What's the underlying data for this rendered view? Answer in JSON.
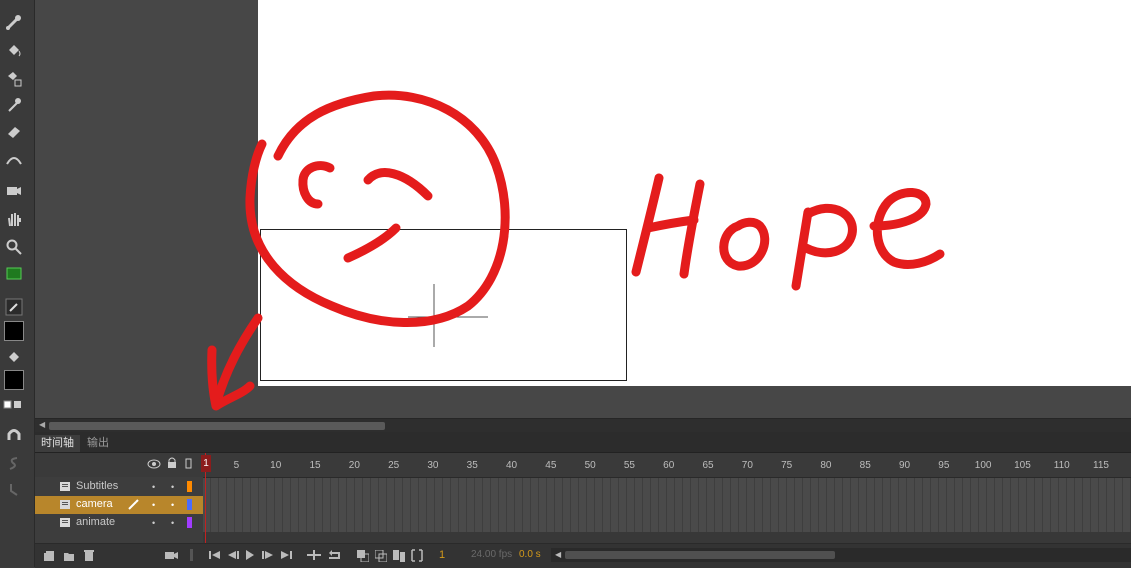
{
  "timeline": {
    "tabs": [
      {
        "label": "时间轴",
        "active": true
      },
      {
        "label": "输出",
        "active": false
      }
    ],
    "current_frame": "1",
    "ruler_ticks": [
      "1",
      "5",
      "10",
      "15",
      "20",
      "25",
      "30",
      "35",
      "40",
      "45",
      "50",
      "55",
      "60",
      "65",
      "70",
      "75",
      "80",
      "85",
      "90",
      "95",
      "100",
      "105",
      "110",
      "115"
    ],
    "layers": [
      {
        "name": "Subtitles",
        "color": "#ff8a00",
        "selected": false
      },
      {
        "name": "camera",
        "color": "#4a6cff",
        "selected": true
      },
      {
        "name": "animate",
        "color": "#a23cff",
        "selected": false
      }
    ],
    "fps": "24.00 fps",
    "time": "0.0 s",
    "frame_readout": "1"
  },
  "annotation": {
    "text": "Hope",
    "color": "#e41c1c"
  },
  "colors": {
    "stroke_color": "#000000",
    "fill_color": "#000000",
    "playhead": "#c32121",
    "selected_layer": "#b8862b"
  }
}
